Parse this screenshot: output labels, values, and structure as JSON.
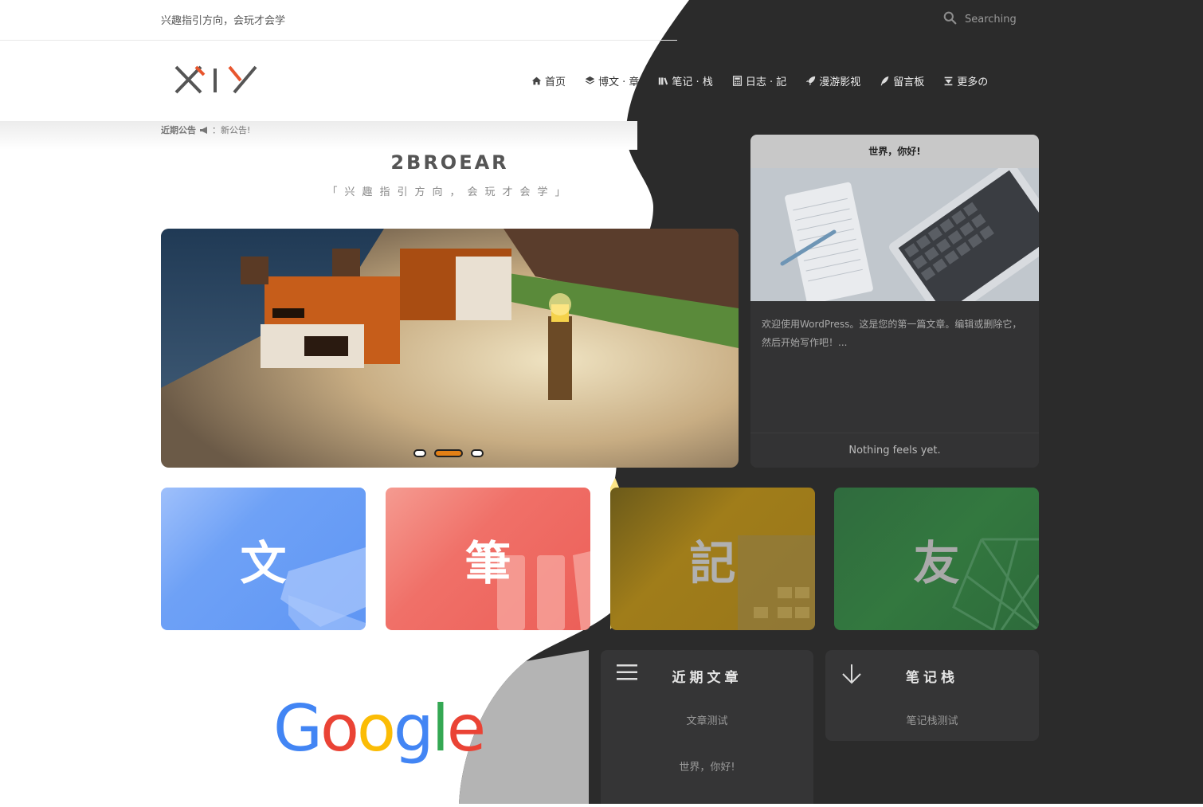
{
  "topbar": {
    "slogan": "兴趣指引方向，会玩才会学",
    "search_placeholder": "Searching"
  },
  "logo": {
    "text": "XIY"
  },
  "nav": [
    {
      "label": "首页",
      "icon": "home-icon"
    },
    {
      "label": "博文 · 章",
      "icon": "layers-icon"
    },
    {
      "label": "笔记 · 栈",
      "icon": "books-icon"
    },
    {
      "label": "日志 · 記",
      "icon": "calculator-icon"
    },
    {
      "label": "漫游影视",
      "icon": "rocket-icon"
    },
    {
      "label": "留言板",
      "icon": "feather-icon"
    },
    {
      "label": "更多の",
      "icon": "sort-down-icon"
    }
  ],
  "notice": {
    "label": "近期公告",
    "text": "：新公告!"
  },
  "site": {
    "title": "2BROEAR",
    "subtitle": "「兴趣指引方向，会玩才会学」"
  },
  "slider": {
    "slide_count": 3,
    "active_index": 1
  },
  "post_card": {
    "title": "世界，你好!",
    "excerpt": "欢迎使用WordPress。这是您的第一篇文章。编辑或删除它，然后开始写作吧！...",
    "footer": "Nothing feels yet."
  },
  "tiles": [
    {
      "char": "文",
      "color": "#6ea1f6",
      "char_color": "#ffffff"
    },
    {
      "char": "筆",
      "color": "#f07068",
      "char_color": "#ffffff"
    },
    {
      "char": "記",
      "color": "#a07d1a",
      "char_color": "#b0b0b0"
    },
    {
      "char": "友",
      "color": "#33783f",
      "char_color": "#a9a9a9"
    }
  ],
  "google": {
    "text": "Google"
  },
  "recent_panel": {
    "title": "近期文章",
    "links": [
      "文章测试",
      "世界，你好!"
    ]
  },
  "notes_panel": {
    "title": "笔记栈",
    "links": [
      "笔记栈测试"
    ]
  },
  "colors": {
    "dark_bg": "#2b2b2b",
    "accent": "#e38016"
  }
}
